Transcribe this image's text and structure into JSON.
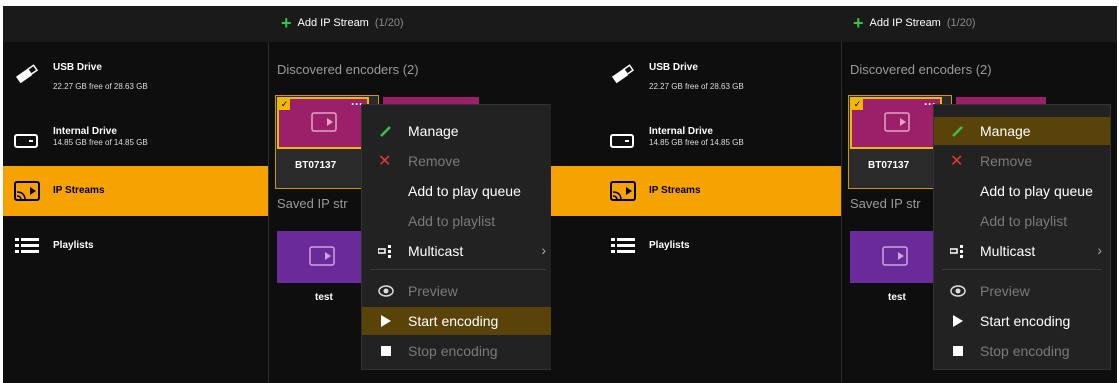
{
  "topbar": {
    "add_label": "Add IP Stream",
    "count": "(1/20)"
  },
  "sidebar": {
    "usb_title": "USB Drive",
    "usb_sub": "22.27 GB free of 28.63 GB",
    "internal_title": "Internal Drive",
    "internal_sub": "14.85 GB free of 14.85 GB",
    "ip_title": "IP Streams",
    "playlists_title": "Playlists"
  },
  "content": {
    "discovered": "Discovered encoders  (2)",
    "saved": "Saved IP str",
    "encoder_name": "BT07137",
    "saved_name": "test"
  },
  "menu": {
    "manage": "Manage",
    "remove": "Remove",
    "add_queue": "Add to play queue",
    "add_playlist": "Add to playlist",
    "multicast": "Multicast",
    "preview": "Preview",
    "start": "Start encoding",
    "stop": "Stop encoding"
  },
  "colors": {
    "accent": "#f6a200",
    "highlight": "#5a4308",
    "encoder_tile": "#9c1f6a",
    "saved_tile": "#6b2a9a"
  }
}
